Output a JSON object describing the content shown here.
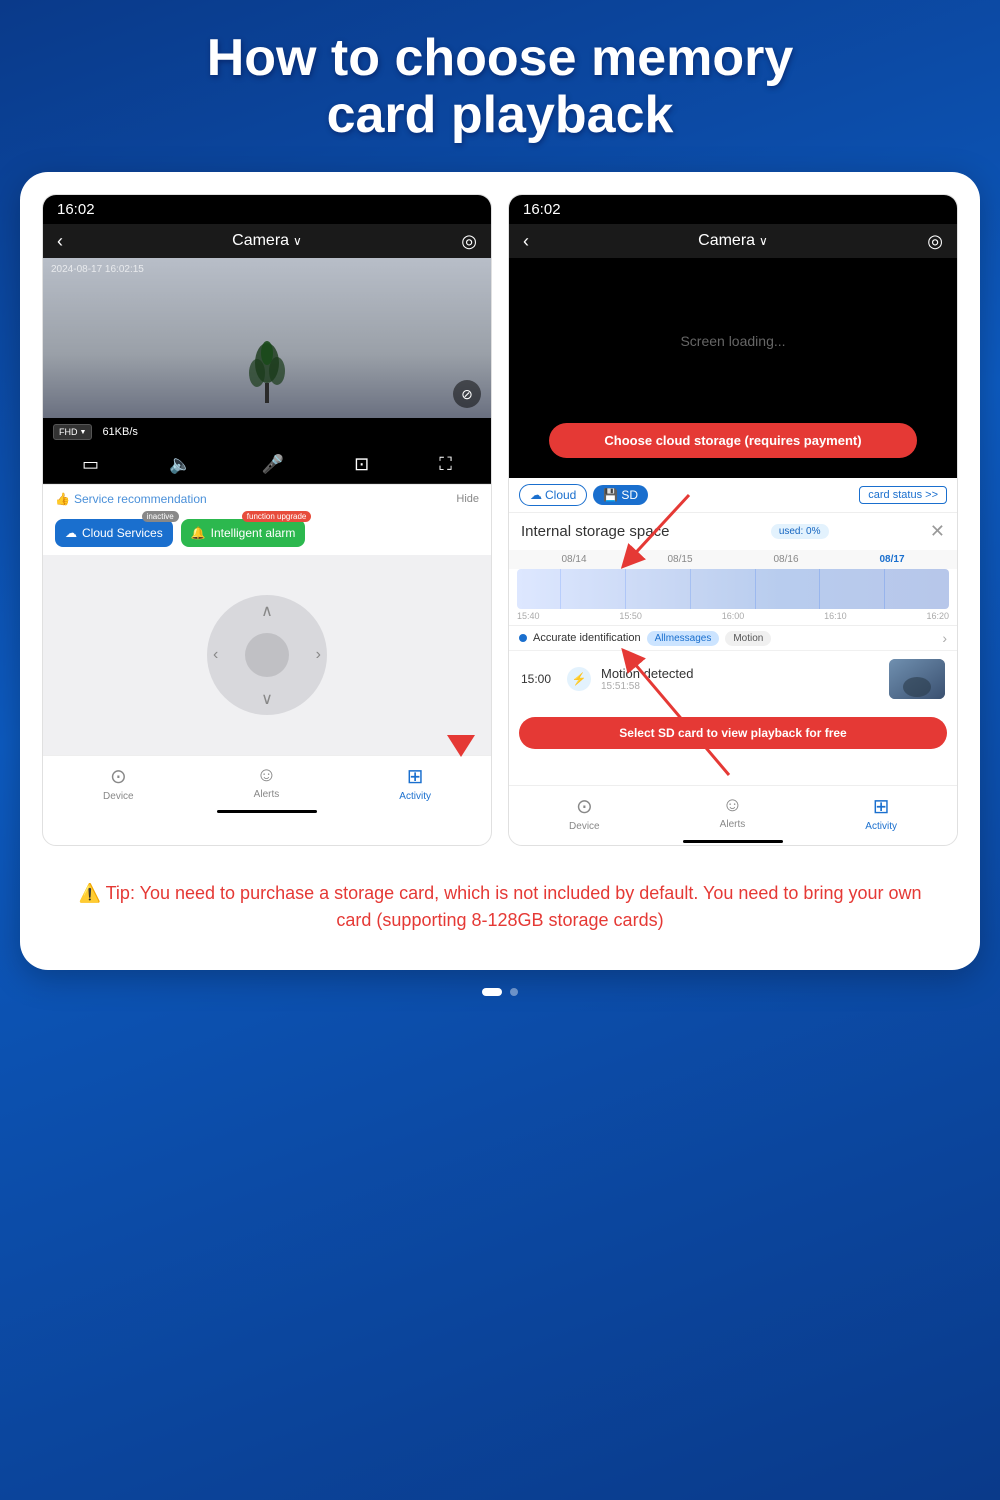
{
  "page": {
    "title_line1": "How to choose memory",
    "title_line2": "card playback",
    "background_color": "#0a3a8a"
  },
  "left_screen": {
    "time": "16:02",
    "camera_label": "Camera",
    "camera_timestamp": "2024-08-17 16:02:15",
    "fhd_label": "FHD",
    "speed": "61KB/s",
    "service_rec_label": "Service recommendation",
    "hide_label": "Hide",
    "cloud_services_label": "Cloud Services",
    "cloud_services_badge": "inactive",
    "alarm_label": "Intelligent alarm",
    "alarm_badge": "function upgrade",
    "nav_device": "Device",
    "nav_alerts": "Alerts",
    "nav_activity": "Activity"
  },
  "right_screen": {
    "time": "16:02",
    "camera_label": "Camera",
    "loading_text": "Screen loading...",
    "cloud_storage_cta": "Choose cloud storage (requires payment)",
    "cloud_tab": "Cloud",
    "sd_tab": "SD",
    "card_status_btn": "card status >>",
    "storage_title": "Internal storage space",
    "used_label": "used: 0%",
    "dates": [
      "08/14",
      "08/15",
      "08/16",
      "08/17"
    ],
    "timeline_labels": [
      "15:40",
      "15:50",
      "16:00",
      "16:10",
      "16:20"
    ],
    "accurate_id_label": "Accurate identification",
    "filter_messages": "Allmessages",
    "filter_motion": "Motion",
    "event_time": "15:00",
    "event_title": "Motion detected",
    "event_subtitle": "15:51:58",
    "sd_callout": "Select SD card to view playback for free",
    "nav_device": "Device",
    "nav_alerts": "Alerts",
    "nav_activity": "Activity"
  },
  "tip": {
    "icon": "⚠️",
    "text": "Tip: You need to purchase a storage card, which is not included by default. You need to bring your own card (supporting 8-128GB storage cards)"
  }
}
